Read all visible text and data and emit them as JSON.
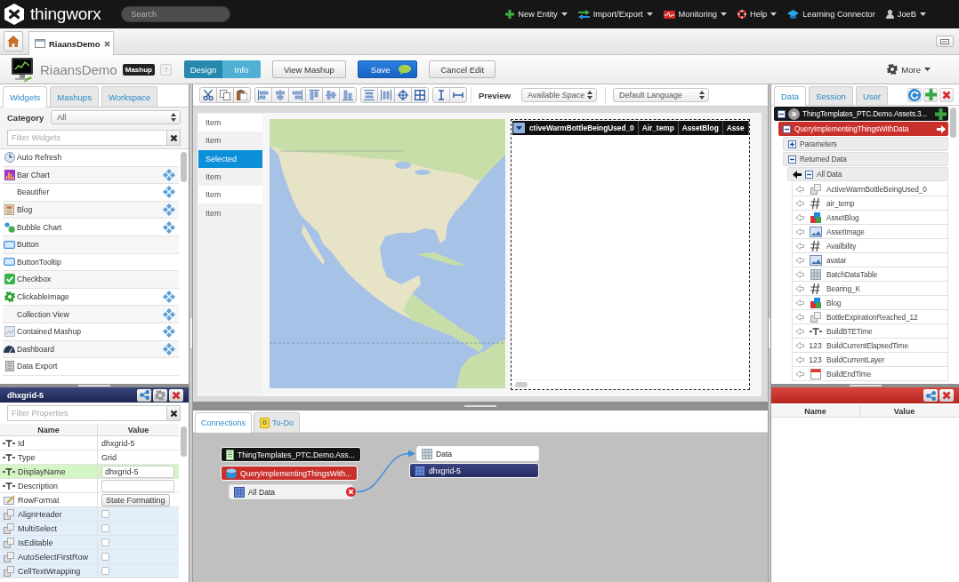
{
  "topbar": {
    "logo": "thingworx",
    "search": {
      "placeholder": "Search"
    },
    "menu": [
      {
        "label": "New Entity",
        "dropdown": true
      },
      {
        "label": "Import/Export",
        "dropdown": true
      },
      {
        "label": "Monitoring",
        "dropdown": true
      },
      {
        "label": "Help",
        "dropdown": true
      },
      {
        "label": "Learning Connector",
        "dropdown": false
      },
      {
        "label": "JoeB",
        "dropdown": true
      }
    ]
  },
  "tabs": [
    {
      "label": "RiaansDemo",
      "selected": true
    }
  ],
  "toolbar": {
    "title": "RiaansDemo",
    "badge": "Mashup",
    "help": "?",
    "modes": [
      {
        "label": "Design",
        "selected": true
      },
      {
        "label": "Info",
        "selected": false
      }
    ],
    "buttons": [
      {
        "label": "View Mashup",
        "kind": "default"
      },
      {
        "label": "Save",
        "kind": "primary"
      },
      {
        "label": "Cancel Edit",
        "kind": "default"
      }
    ],
    "more": {
      "label": "More",
      "dropdown": true
    }
  },
  "widgets_panel": {
    "tabs": [
      {
        "label": "Widgets",
        "selected": true
      },
      {
        "label": "Mashups",
        "selected": false
      },
      {
        "label": "Workspace",
        "selected": false
      }
    ],
    "category": {
      "label": "Category",
      "value": "All"
    },
    "filter": {
      "placeholder": "Filter Widgets"
    },
    "items": [
      {
        "label": "Auto Refresh",
        "extension": false
      },
      {
        "label": "Bar Chart",
        "extension": true
      },
      {
        "label": "Beautifier",
        "extension": true
      },
      {
        "label": "Blog",
        "extension": true
      },
      {
        "label": "Bubble Chart",
        "extension": true
      },
      {
        "label": "Button",
        "extension": false
      },
      {
        "label": "ButtonTooltip",
        "extension": false
      },
      {
        "label": "Checkbox",
        "extension": false
      },
      {
        "label": "ClickableImage",
        "extension": true
      },
      {
        "label": "Collection View",
        "extension": true
      },
      {
        "label": "Contained Mashup",
        "extension": true
      },
      {
        "label": "Dashboard",
        "extension": true
      },
      {
        "label": "Data Export",
        "extension": false
      }
    ]
  },
  "properties_panel": {
    "title": "dhxgrid-5",
    "filter": {
      "placeholder": "Filter Properties"
    },
    "columns": [
      "Name",
      "Value"
    ],
    "rows": [
      {
        "name": "Id",
        "kind": "text",
        "value": "dhxgrid-5",
        "selected": false
      },
      {
        "name": "Type",
        "kind": "text",
        "value": "Grid",
        "selected": false
      },
      {
        "name": "DisplayName",
        "kind": "input",
        "value": "dhxgrid-5",
        "selected": true
      },
      {
        "name": "Description",
        "kind": "input",
        "selected": false
      },
      {
        "name": "RowFormat",
        "kind": "button",
        "value": "State Formatting",
        "selected": false
      },
      {
        "name": "AlignHeader",
        "kind": "checkbox",
        "checked": false,
        "selected": false
      },
      {
        "name": "MultiSelect",
        "kind": "checkbox",
        "checked": false,
        "selected": false
      },
      {
        "name": "IsEditable",
        "kind": "checkbox",
        "checked": false,
        "selected": false
      },
      {
        "name": "AutoSelectFirstRow",
        "kind": "checkbox",
        "checked": false,
        "selected": false
      },
      {
        "name": "CellTextWrapping",
        "kind": "checkbox",
        "checked": false,
        "selected": false
      }
    ]
  },
  "canvas": {
    "toolbar": {
      "preview_label": "Preview",
      "preview": "Available Space",
      "language": "Default Language"
    },
    "list_items": [
      {
        "label": "Item",
        "selected": false
      },
      {
        "label": "Item",
        "selected": false
      },
      {
        "label": "Selected",
        "selected": true
      },
      {
        "label": "Item",
        "selected": false
      },
      {
        "label": "Item",
        "selected": false
      },
      {
        "label": "Item",
        "selected": false
      }
    ],
    "grid": {
      "selected": true,
      "columns": [
        "ctiveWarmBottleBeingUsed_0",
        "Air_temp",
        "AssetBlog",
        "Asse"
      ]
    }
  },
  "connections_panel": {
    "tabs": [
      {
        "label": "Connections",
        "selected": true
      },
      {
        "label": "To-Do",
        "selected": false,
        "count": "0"
      }
    ],
    "nodes": [
      {
        "label": "ThingTemplates_PTC.Demo.Ass...",
        "kind": "thing"
      },
      {
        "label": "QueryImplementingThingsWith...",
        "kind": "service"
      },
      {
        "label": "All Data",
        "kind": "source",
        "bound": true
      },
      {
        "label": "Data",
        "kind": "target"
      },
      {
        "label": "dhxgrid-5",
        "kind": "widget"
      }
    ]
  },
  "data_panel": {
    "tabs": [
      {
        "label": "Data",
        "selected": true
      },
      {
        "label": "Session",
        "selected": false
      },
      {
        "label": "User",
        "selected": false
      }
    ],
    "tree": [
      {
        "label": "ThingTemplates_PTC.Demo.Assets.3...",
        "kind": "thing",
        "expanded": true,
        "children": [
          {
            "label": "QueryImplementingThingsWithData",
            "kind": "service",
            "expanded": true,
            "children": [
              {
                "label": "Parameters",
                "kind": "section",
                "expanded": false
              },
              {
                "label": "Returned Data",
                "kind": "section",
                "expanded": true,
                "children": [
                  {
                    "label": "All Data",
                    "kind": "result",
                    "expanded": true,
                    "children": [
                      {
                        "label": "ActiveWarmBottleBeingUsed_0",
                        "kind": "boolean"
                      },
                      {
                        "label": "air_temp",
                        "kind": "number"
                      },
                      {
                        "label": "AssetBlog",
                        "kind": "blog"
                      },
                      {
                        "label": "AssetImage",
                        "kind": "image"
                      },
                      {
                        "label": "Availbility",
                        "kind": "number"
                      },
                      {
                        "label": "avatar",
                        "kind": "image"
                      },
                      {
                        "label": "BatchDataTable",
                        "kind": "infotable"
                      },
                      {
                        "label": "Bearing_K",
                        "kind": "number"
                      },
                      {
                        "label": "Blog",
                        "kind": "blog"
                      },
                      {
                        "label": "BottleExpirationReached_12",
                        "kind": "boolean"
                      },
                      {
                        "label": "BuildBTETime",
                        "kind": "string"
                      },
                      {
                        "label": "BuildCurrentElapsedTime",
                        "kind": "integer",
                        "glyph": "123"
                      },
                      {
                        "label": "BuildCurrentLayer",
                        "kind": "integer",
                        "glyph": "123"
                      },
                      {
                        "label": "BuildEndTime",
                        "kind": "datetime"
                      }
                    ]
                  }
                ]
              }
            ]
          }
        ]
      }
    ]
  },
  "selection_panel": {
    "columns": [
      "Name",
      "Value"
    ]
  }
}
